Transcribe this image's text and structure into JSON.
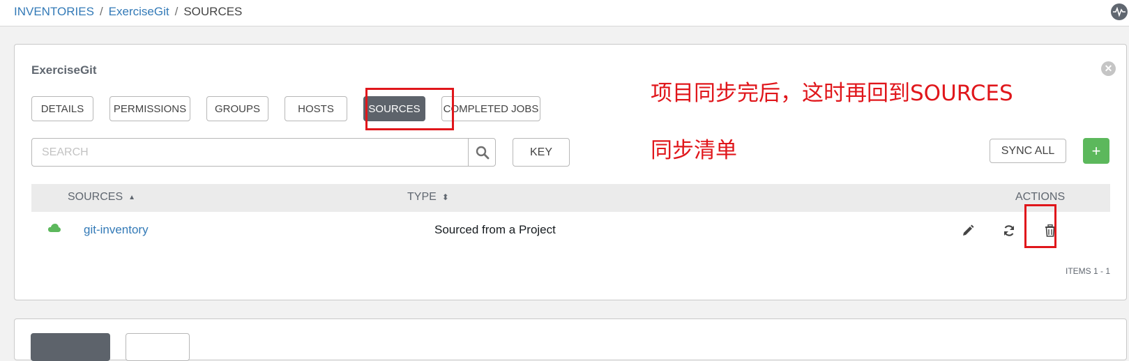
{
  "breadcrumb": {
    "inventories": "INVENTORIES",
    "inventory": "ExerciseGit",
    "current": "SOURCES",
    "sep1": "/",
    "sep2": "/"
  },
  "panel": {
    "title": "ExerciseGit",
    "close_icon": "times-circle-icon"
  },
  "tabs": [
    {
      "label": "DETAILS"
    },
    {
      "label": "PERMISSIONS"
    },
    {
      "label": "GROUPS"
    },
    {
      "label": "HOSTS"
    },
    {
      "label": "SOURCES",
      "active": true
    },
    {
      "label": "COMPLETED JOBS"
    }
  ],
  "search": {
    "placeholder": "SEARCH",
    "value": "",
    "icon": "search-icon"
  },
  "toolbar": {
    "key_label": "KEY",
    "sync_all_label": "SYNC ALL",
    "add_label": "+"
  },
  "table": {
    "columns": {
      "sources": "SOURCES",
      "type": "TYPE",
      "actions": "ACTIONS"
    },
    "sort_icons": {
      "sources": "▲",
      "type": "⬍"
    },
    "rows": [
      {
        "name": "git-inventory",
        "type": "Sourced from a Project",
        "status_icon": "cloud-icon",
        "actions": [
          "edit-icon",
          "sync-icon",
          "trash-icon"
        ]
      }
    ],
    "items_count": "ITEMS  1 - 1"
  },
  "annotation": {
    "line1": "项目同步完后，这时再回到SOURCES",
    "line2": "同步清单"
  },
  "colors": {
    "accent": "#337ab7",
    "active_tab": "#5d636b",
    "add": "#5cb85c",
    "annotation": "#e0161b",
    "cloud": "#5cb85c"
  }
}
